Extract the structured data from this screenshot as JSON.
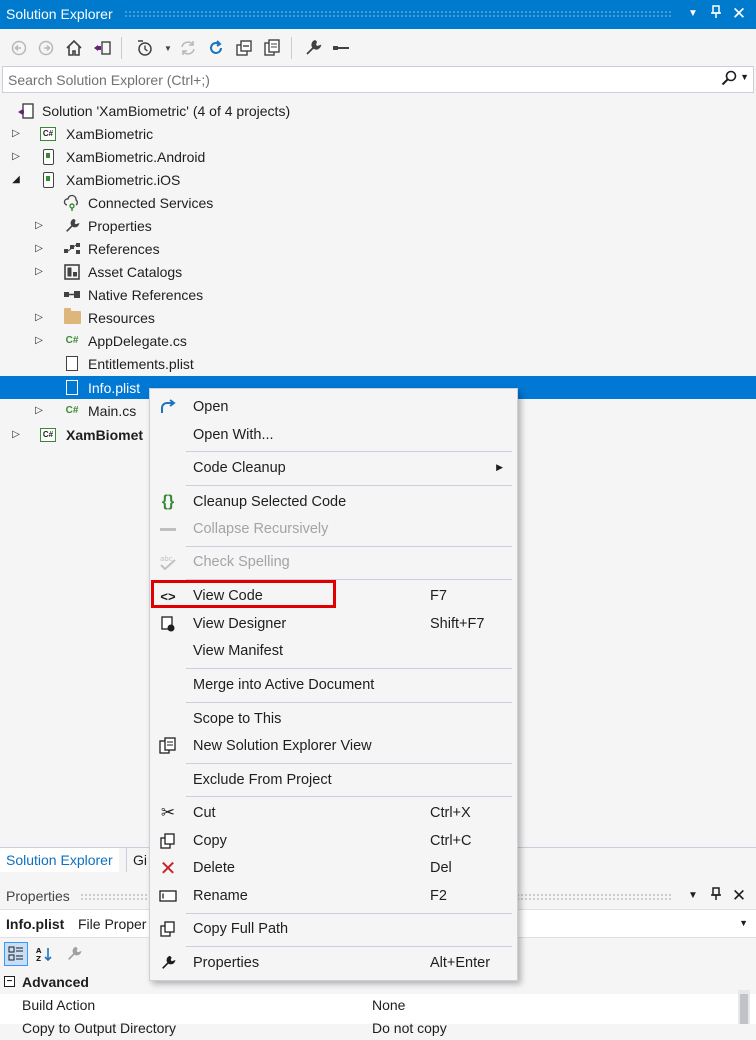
{
  "solution_explorer": {
    "title": "Solution Explorer",
    "search_placeholder": "Search Solution Explorer (Ctrl+;)"
  },
  "tree": {
    "solution": "Solution 'XamBiometric' (4 of 4 projects)",
    "project1": "XamBiometric",
    "project2": "XamBiometric.Android",
    "project3": "XamBiometric.iOS",
    "connected_services": "Connected Services",
    "properties": "Properties",
    "references": "References",
    "asset_catalogs": "Asset Catalogs",
    "native_references": "Native References",
    "resources": "Resources",
    "app_delegate": "AppDelegate.cs",
    "entitlements": "Entitlements.plist",
    "info_plist": "Info.plist",
    "main_cs": "Main.cs",
    "project4": "XamBiomet"
  },
  "bottom_tabs": {
    "solution_explorer": "Solution Explorer",
    "other": "Gi"
  },
  "properties_panel": {
    "title": "Properties",
    "object_name": "Info.plist",
    "object_kind": "File Proper",
    "category": "Advanced",
    "rows": [
      {
        "key": "Build Action",
        "value": "None"
      },
      {
        "key": "Copy to Output Directory",
        "value": "Do not copy"
      }
    ]
  },
  "context_menu": {
    "open": "Open",
    "open_with": "Open With...",
    "code_cleanup": "Code Cleanup",
    "cleanup_selected_code": "Cleanup Selected Code",
    "collapse_recursively": "Collapse Recursively",
    "check_spelling": "Check Spelling",
    "view_code": "View Code",
    "view_code_key": "F7",
    "view_designer": "View Designer",
    "view_designer_key": "Shift+F7",
    "view_manifest": "View Manifest",
    "merge": "Merge into Active Document",
    "scope_to_this": "Scope to This",
    "new_se_view": "New Solution Explorer View",
    "exclude": "Exclude From Project",
    "cut": "Cut",
    "cut_key": "Ctrl+X",
    "copy": "Copy",
    "copy_key": "Ctrl+C",
    "delete": "Delete",
    "delete_key": "Del",
    "rename": "Rename",
    "rename_key": "F2",
    "copy_full_path": "Copy Full Path",
    "properties": "Properties",
    "properties_key": "Alt+Enter"
  },
  "colors": {
    "accent": "#007acc",
    "selection": "#0078d4",
    "highlight_box": "#e00000"
  }
}
